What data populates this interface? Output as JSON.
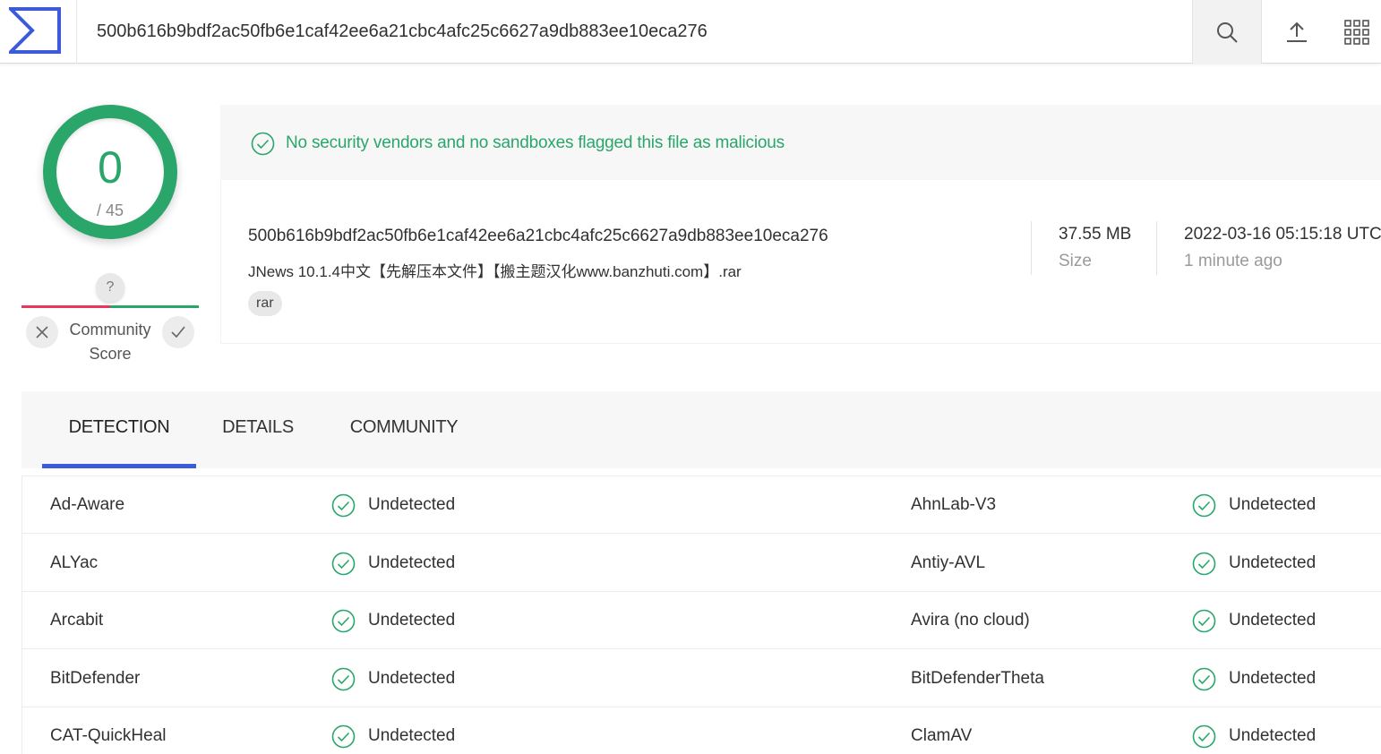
{
  "header": {
    "search_value": "500b616b9bdf2ac50fb6e1caf42ee6a21cbc4afc25c6627a9db883ee10eca276",
    "icons": [
      "virustotal-logo-icon",
      "search-icon",
      "upload-icon",
      "apps-grid-icon"
    ]
  },
  "score": {
    "detections": "0",
    "total": "/ 45",
    "community_question": "?",
    "community_label_1": "Community",
    "community_label_2": "Score"
  },
  "banner": {
    "text": "No security vendors and no sandboxes flagged this file as malicious"
  },
  "file": {
    "hash": "500b616b9bdf2ac50fb6e1caf42ee6a21cbc4afc25c6627a9db883ee10eca276",
    "name": "JNews 10.1.4中文【先解压本文件】【搬主题汉化www.banzhuti.com】.rar",
    "tag": "rar",
    "size_value": "37.55 MB",
    "size_label": "Size",
    "date_value": "2022-03-16 05:15:18 UTC",
    "date_label": "1 minute ago"
  },
  "tabs": [
    {
      "label": "DETECTION"
    },
    {
      "label": "DETAILS"
    },
    {
      "label": "COMMUNITY"
    }
  ],
  "detections": [
    {
      "left_vendor": "Ad-Aware",
      "left_result": "Undetected",
      "right_vendor": "AhnLab-V3",
      "right_result": "Undetected"
    },
    {
      "left_vendor": "ALYac",
      "left_result": "Undetected",
      "right_vendor": "Antiy-AVL",
      "right_result": "Undetected"
    },
    {
      "left_vendor": "Arcabit",
      "left_result": "Undetected",
      "right_vendor": "Avira (no cloud)",
      "right_result": "Undetected"
    },
    {
      "left_vendor": "BitDefender",
      "left_result": "Undetected",
      "right_vendor": "BitDefenderTheta",
      "right_result": "Undetected"
    },
    {
      "left_vendor": "CAT-QuickHeal",
      "left_result": "Undetected",
      "right_vendor": "ClamAV",
      "right_result": "Undetected"
    }
  ],
  "colors": {
    "clean_green": "#2aa66b",
    "accent_blue": "#3b5bdb",
    "community_red": "#e8365d"
  }
}
